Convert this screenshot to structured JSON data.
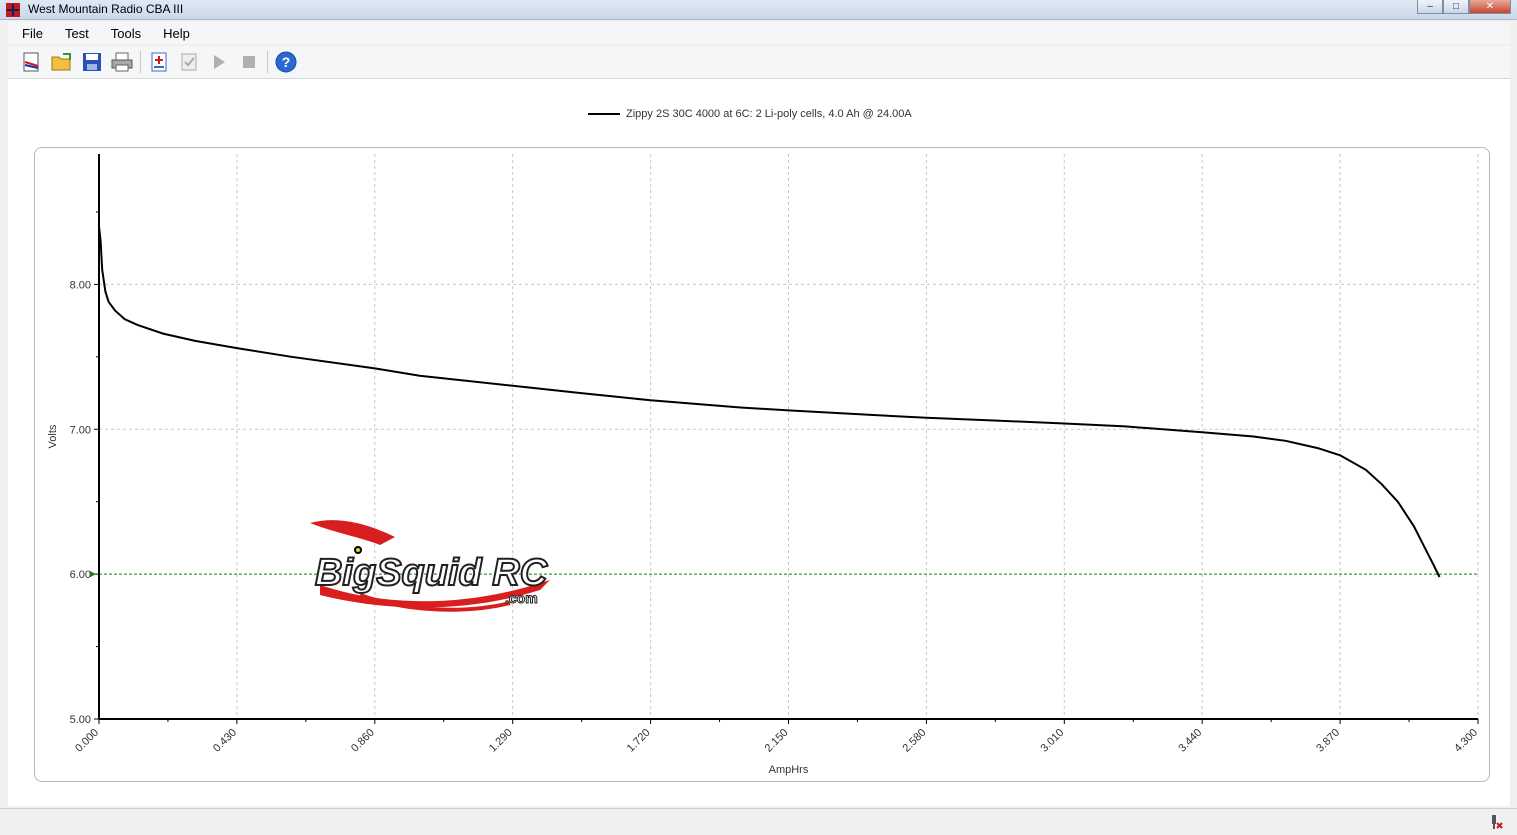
{
  "window": {
    "title": "West Mountain Radio CBA III",
    "controls": [
      "minimize",
      "maximize",
      "close"
    ]
  },
  "menu": [
    {
      "label": "File"
    },
    {
      "label": "Test"
    },
    {
      "label": "Tools"
    },
    {
      "label": "Help"
    }
  ],
  "toolbar": {
    "icons": [
      "new-test-icon",
      "open-folder-icon",
      "save-icon",
      "print-icon",
      "add-report-icon",
      "checklist-icon",
      "play-icon",
      "stop-icon",
      "help-icon"
    ]
  },
  "watermark": {
    "text": "BigSquid RC",
    "suffix": ".com"
  },
  "colors": {
    "line": "#000000",
    "cutoff": "#1a7a1a",
    "grid": "#c8c8c8",
    "accent_red": "#d81e1e"
  },
  "chart_data": {
    "type": "line",
    "legend": "Zippy 2S 30C 4000 at 6C: 2 Li-poly cells, 4.0 Ah @ 24.00A",
    "xlabel": "AmpHrs",
    "ylabel": "Volts",
    "xlim": [
      0,
      4.3
    ],
    "ylim": [
      5.0,
      8.9
    ],
    "xticks": [
      "0.000",
      "0.430",
      "0.860",
      "1.290",
      "1.720",
      "2.150",
      "2.580",
      "3.010",
      "3.440",
      "3.870",
      "4.300"
    ],
    "yticks": [
      "5.00",
      "6.00",
      "7.00",
      "8.00"
    ],
    "cutoff": 6.0,
    "grid": true,
    "series": [
      {
        "name": "Zippy 2S 30C 4000 at 6C",
        "x": [
          0.0,
          0.005,
          0.01,
          0.02,
          0.03,
          0.05,
          0.08,
          0.12,
          0.2,
          0.3,
          0.43,
          0.6,
          0.86,
          1.0,
          1.29,
          1.5,
          1.72,
          2.0,
          2.15,
          2.4,
          2.58,
          2.8,
          3.01,
          3.2,
          3.44,
          3.6,
          3.7,
          3.8,
          3.87,
          3.95,
          4.0,
          4.05,
          4.1,
          4.13,
          4.16,
          4.18
        ],
        "y": [
          8.4,
          8.3,
          8.1,
          7.95,
          7.88,
          7.82,
          7.76,
          7.72,
          7.66,
          7.61,
          7.56,
          7.5,
          7.42,
          7.37,
          7.3,
          7.25,
          7.2,
          7.15,
          7.13,
          7.1,
          7.08,
          7.06,
          7.04,
          7.02,
          6.98,
          6.95,
          6.92,
          6.87,
          6.82,
          6.72,
          6.62,
          6.5,
          6.33,
          6.2,
          6.07,
          5.98
        ]
      }
    ]
  }
}
